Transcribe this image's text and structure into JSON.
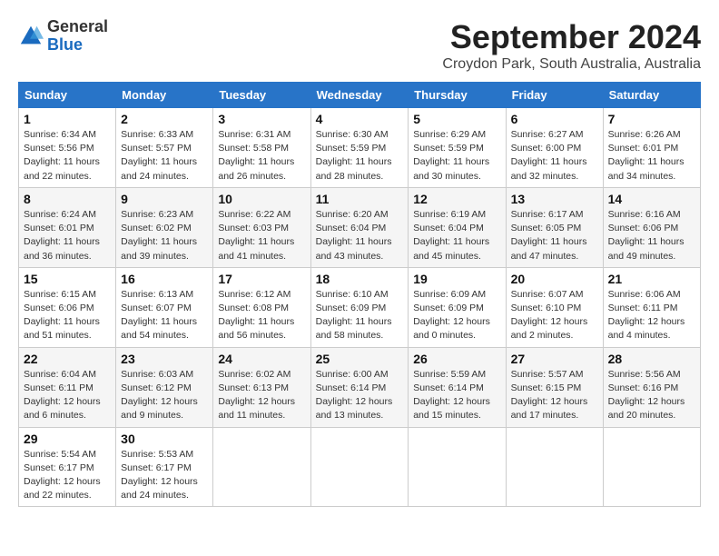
{
  "header": {
    "logo_line1": "General",
    "logo_line2": "Blue",
    "month_title": "September 2024",
    "location": "Croydon Park, South Australia, Australia"
  },
  "weekdays": [
    "Sunday",
    "Monday",
    "Tuesday",
    "Wednesday",
    "Thursday",
    "Friday",
    "Saturday"
  ],
  "weeks": [
    [
      {
        "day": "1",
        "sunrise": "6:34 AM",
        "sunset": "5:56 PM",
        "daylight": "11 hours and 22 minutes."
      },
      {
        "day": "2",
        "sunrise": "6:33 AM",
        "sunset": "5:57 PM",
        "daylight": "11 hours and 24 minutes."
      },
      {
        "day": "3",
        "sunrise": "6:31 AM",
        "sunset": "5:58 PM",
        "daylight": "11 hours and 26 minutes."
      },
      {
        "day": "4",
        "sunrise": "6:30 AM",
        "sunset": "5:59 PM",
        "daylight": "11 hours and 28 minutes."
      },
      {
        "day": "5",
        "sunrise": "6:29 AM",
        "sunset": "5:59 PM",
        "daylight": "11 hours and 30 minutes."
      },
      {
        "day": "6",
        "sunrise": "6:27 AM",
        "sunset": "6:00 PM",
        "daylight": "11 hours and 32 minutes."
      },
      {
        "day": "7",
        "sunrise": "6:26 AM",
        "sunset": "6:01 PM",
        "daylight": "11 hours and 34 minutes."
      }
    ],
    [
      {
        "day": "8",
        "sunrise": "6:24 AM",
        "sunset": "6:01 PM",
        "daylight": "11 hours and 36 minutes."
      },
      {
        "day": "9",
        "sunrise": "6:23 AM",
        "sunset": "6:02 PM",
        "daylight": "11 hours and 39 minutes."
      },
      {
        "day": "10",
        "sunrise": "6:22 AM",
        "sunset": "6:03 PM",
        "daylight": "11 hours and 41 minutes."
      },
      {
        "day": "11",
        "sunrise": "6:20 AM",
        "sunset": "6:04 PM",
        "daylight": "11 hours and 43 minutes."
      },
      {
        "day": "12",
        "sunrise": "6:19 AM",
        "sunset": "6:04 PM",
        "daylight": "11 hours and 45 minutes."
      },
      {
        "day": "13",
        "sunrise": "6:17 AM",
        "sunset": "6:05 PM",
        "daylight": "11 hours and 47 minutes."
      },
      {
        "day": "14",
        "sunrise": "6:16 AM",
        "sunset": "6:06 PM",
        "daylight": "11 hours and 49 minutes."
      }
    ],
    [
      {
        "day": "15",
        "sunrise": "6:15 AM",
        "sunset": "6:06 PM",
        "daylight": "11 hours and 51 minutes."
      },
      {
        "day": "16",
        "sunrise": "6:13 AM",
        "sunset": "6:07 PM",
        "daylight": "11 hours and 54 minutes."
      },
      {
        "day": "17",
        "sunrise": "6:12 AM",
        "sunset": "6:08 PM",
        "daylight": "11 hours and 56 minutes."
      },
      {
        "day": "18",
        "sunrise": "6:10 AM",
        "sunset": "6:09 PM",
        "daylight": "11 hours and 58 minutes."
      },
      {
        "day": "19",
        "sunrise": "6:09 AM",
        "sunset": "6:09 PM",
        "daylight": "12 hours and 0 minutes."
      },
      {
        "day": "20",
        "sunrise": "6:07 AM",
        "sunset": "6:10 PM",
        "daylight": "12 hours and 2 minutes."
      },
      {
        "day": "21",
        "sunrise": "6:06 AM",
        "sunset": "6:11 PM",
        "daylight": "12 hours and 4 minutes."
      }
    ],
    [
      {
        "day": "22",
        "sunrise": "6:04 AM",
        "sunset": "6:11 PM",
        "daylight": "12 hours and 6 minutes."
      },
      {
        "day": "23",
        "sunrise": "6:03 AM",
        "sunset": "6:12 PM",
        "daylight": "12 hours and 9 minutes."
      },
      {
        "day": "24",
        "sunrise": "6:02 AM",
        "sunset": "6:13 PM",
        "daylight": "12 hours and 11 minutes."
      },
      {
        "day": "25",
        "sunrise": "6:00 AM",
        "sunset": "6:14 PM",
        "daylight": "12 hours and 13 minutes."
      },
      {
        "day": "26",
        "sunrise": "5:59 AM",
        "sunset": "6:14 PM",
        "daylight": "12 hours and 15 minutes."
      },
      {
        "day": "27",
        "sunrise": "5:57 AM",
        "sunset": "6:15 PM",
        "daylight": "12 hours and 17 minutes."
      },
      {
        "day": "28",
        "sunrise": "5:56 AM",
        "sunset": "6:16 PM",
        "daylight": "12 hours and 20 minutes."
      }
    ],
    [
      {
        "day": "29",
        "sunrise": "5:54 AM",
        "sunset": "6:17 PM",
        "daylight": "12 hours and 22 minutes."
      },
      {
        "day": "30",
        "sunrise": "5:53 AM",
        "sunset": "6:17 PM",
        "daylight": "12 hours and 24 minutes."
      },
      null,
      null,
      null,
      null,
      null
    ]
  ]
}
